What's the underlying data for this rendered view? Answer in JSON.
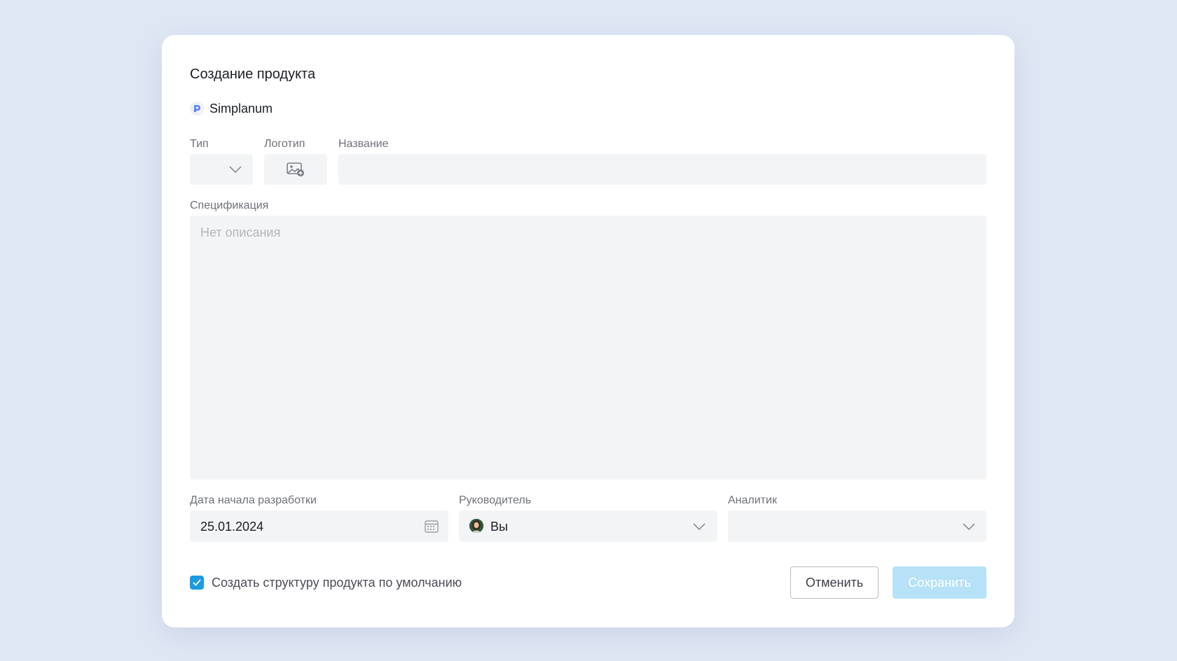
{
  "dialog": {
    "title": "Создание продукта",
    "workspace_name": "Simplanum"
  },
  "form": {
    "type_label": "Тип",
    "logo_label": "Логотип",
    "name_label": "Название",
    "name_value": "",
    "spec_label": "Спецификация",
    "spec_placeholder": "Нет описания",
    "start_date_label": "Дата начала разработки",
    "start_date_value": "25.01.2024",
    "manager_label": "Руководитель",
    "manager_value": "Вы",
    "analyst_label": "Аналитик",
    "analyst_value": ""
  },
  "options": {
    "default_structure_label": "Создать структуру продукта по умолчанию",
    "default_structure_checked": true
  },
  "actions": {
    "cancel_label": "Отменить",
    "save_label": "Сохранить"
  },
  "colors": {
    "page_bg": "#e0e7f4",
    "field_bg": "#f3f4f6",
    "accent": "#1b9be0",
    "save_disabled": "#b6e1f7"
  },
  "icons": {
    "workspace": "simplanum-logo-icon",
    "type_dropdown": "chevron-down-icon",
    "logo_upload": "image-add-icon",
    "date_picker": "calendar-icon",
    "checkbox": "check-icon"
  }
}
